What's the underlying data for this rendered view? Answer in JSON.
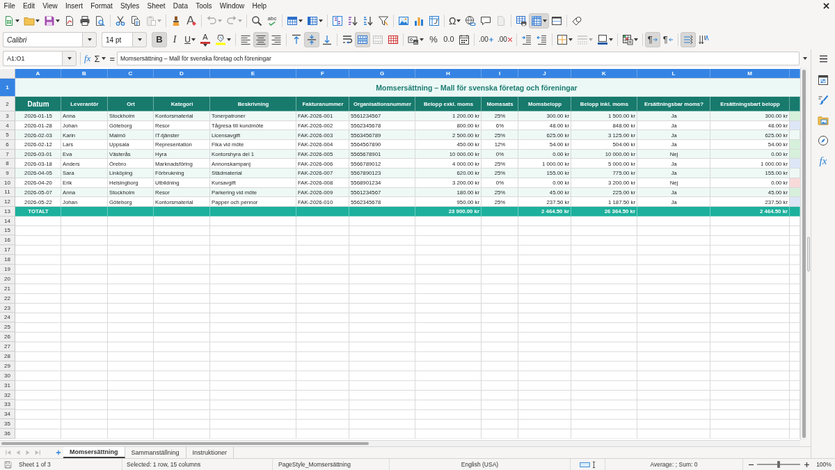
{
  "menu_bar": {
    "items": [
      "File",
      "Edit",
      "View",
      "Insert",
      "Format",
      "Styles",
      "Sheet",
      "Data",
      "Tools",
      "Window",
      "Help"
    ]
  },
  "standard_toolbar": {
    "groups": [
      {
        "items": [
          {
            "kind": "new",
            "dropdown": true,
            "on": false,
            "disabled": false
          },
          {
            "kind": "open",
            "dropdown": true,
            "on": false,
            "disabled": false
          },
          {
            "kind": "save",
            "dropdown": true,
            "on": false,
            "disabled": false
          },
          {
            "kind": "export_pdf",
            "dropdown": false,
            "on": false,
            "disabled": false
          },
          {
            "kind": "print",
            "dropdown": false,
            "on": false,
            "disabled": false
          },
          {
            "kind": "print_preview",
            "dropdown": false,
            "on": false,
            "disabled": false
          }
        ]
      },
      {
        "items": [
          {
            "kind": "cut",
            "dropdown": false,
            "on": false,
            "disabled": false
          },
          {
            "kind": "copy",
            "dropdown": false,
            "on": false,
            "disabled": false
          },
          {
            "kind": "paste",
            "dropdown": true,
            "on": false,
            "disabled": true
          }
        ]
      },
      {
        "items": [
          {
            "kind": "clone_formatting",
            "dropdown": false,
            "on": false,
            "disabled": false
          },
          {
            "kind": "clear_formatting",
            "dropdown": false,
            "on": false,
            "disabled": false
          }
        ]
      },
      {
        "items": [
          {
            "kind": "undo",
            "dropdown": true,
            "on": false,
            "disabled": true
          },
          {
            "kind": "redo",
            "dropdown": true,
            "on": false,
            "disabled": true
          }
        ]
      },
      {
        "items": [
          {
            "kind": "find_replace",
            "dropdown": false,
            "on": false,
            "disabled": false
          },
          {
            "kind": "spelling",
            "glyph": "abc",
            "dropdown": false,
            "on": false,
            "disabled": false
          }
        ]
      },
      {
        "items": [
          {
            "kind": "row",
            "dropdown": true,
            "on": false,
            "disabled": false
          },
          {
            "kind": "column",
            "dropdown": true,
            "on": false,
            "disabled": false
          }
        ]
      },
      {
        "items": [
          {
            "kind": "sort",
            "dropdown": false,
            "on": false,
            "disabled": false
          },
          {
            "kind": "sort_ascending",
            "dropdown": false,
            "on": false,
            "disabled": false
          },
          {
            "kind": "sort_descending",
            "dropdown": false,
            "on": false,
            "disabled": false
          },
          {
            "kind": "autofilter",
            "dropdown": false,
            "on": false,
            "disabled": false
          }
        ]
      },
      {
        "items": [
          {
            "kind": "image",
            "dropdown": false,
            "on": false,
            "disabled": false
          },
          {
            "kind": "chart",
            "dropdown": false,
            "on": false,
            "disabled": false
          },
          {
            "kind": "pivot_table",
            "dropdown": false,
            "on": false,
            "disabled": false
          }
        ]
      },
      {
        "items": [
          {
            "kind": "special_character",
            "glyph": "Ω",
            "dropdown": true,
            "on": false,
            "disabled": false
          },
          {
            "kind": "hyperlink",
            "dropdown": false,
            "on": false,
            "disabled": false
          },
          {
            "kind": "comment",
            "dropdown": false,
            "on": false,
            "disabled": false
          },
          {
            "kind": "header_footer",
            "dropdown": false,
            "on": false,
            "disabled": true
          }
        ]
      },
      {
        "items": [
          {
            "kind": "print_area",
            "dropdown": false,
            "on": false,
            "disabled": false
          },
          {
            "kind": "freeze",
            "dropdown": true,
            "on": true,
            "disabled": false
          },
          {
            "kind": "split_window",
            "dropdown": false,
            "on": false,
            "disabled": false
          }
        ]
      },
      {
        "items": [
          {
            "kind": "draw_functions",
            "dropdown": false,
            "on": false,
            "disabled": false
          }
        ]
      }
    ]
  },
  "formatting_toolbar": {
    "font_name": "Calibri",
    "font_size": "14 pt",
    "groups": [
      {
        "items": [
          {
            "kind": "bold",
            "glyph": "B",
            "dropdown": false,
            "on": true,
            "disabled": false
          },
          {
            "kind": "italic",
            "glyph": "I",
            "dropdown": false,
            "on": false,
            "disabled": false
          },
          {
            "kind": "underline",
            "glyph": "U",
            "dropdown": true,
            "on": false,
            "disabled": false
          },
          {
            "kind": "font_color",
            "glyph": "A",
            "dropdown": true,
            "on": false,
            "disabled": false
          },
          {
            "kind": "highlight",
            "dropdown": true,
            "on": false,
            "disabled": false
          }
        ]
      },
      {
        "items": [
          {
            "kind": "align_left",
            "dropdown": false,
            "on": false,
            "disabled": false
          },
          {
            "kind": "align_center",
            "dropdown": false,
            "on": true,
            "disabled": false
          },
          {
            "kind": "align_right",
            "dropdown": false,
            "on": false,
            "disabled": false
          }
        ]
      },
      {
        "items": [
          {
            "kind": "align_top",
            "dropdown": false,
            "on": false,
            "disabled": false
          },
          {
            "kind": "center_vertically",
            "dropdown": false,
            "on": true,
            "disabled": false
          },
          {
            "kind": "align_bottom",
            "dropdown": false,
            "on": false,
            "disabled": false
          }
        ]
      },
      {
        "items": [
          {
            "kind": "wrap_text",
            "dropdown": false,
            "on": false,
            "disabled": false
          },
          {
            "kind": "merge_center",
            "dropdown": false,
            "on": true,
            "disabled": false
          },
          {
            "kind": "merge_cells",
            "dropdown": false,
            "on": false,
            "disabled": true
          },
          {
            "kind": "unmerge",
            "dropdown": false,
            "on": false,
            "disabled": false
          }
        ]
      },
      {
        "items": [
          {
            "kind": "currency",
            "dropdown": true,
            "on": false,
            "disabled": false
          },
          {
            "kind": "percent",
            "glyph": "%",
            "dropdown": false,
            "on": false,
            "disabled": false
          },
          {
            "kind": "standard_format",
            "glyph": "0.0",
            "dropdown": false,
            "on": false,
            "disabled": false
          },
          {
            "kind": "date",
            "dropdown": false,
            "on": false,
            "disabled": false
          }
        ]
      },
      {
        "items": [
          {
            "kind": "add_decimal",
            "glyph": ".00",
            "dropdown": false,
            "on": false,
            "disabled": false
          },
          {
            "kind": "delete_decimal",
            "glyph": ".00",
            "dropdown": false,
            "on": false,
            "disabled": false
          }
        ]
      },
      {
        "items": [
          {
            "kind": "increase_indent",
            "dropdown": false,
            "on": false,
            "disabled": false
          },
          {
            "kind": "decrease_indent",
            "dropdown": false,
            "on": false,
            "disabled": false
          }
        ]
      },
      {
        "items": [
          {
            "kind": "borders",
            "dropdown": true,
            "on": false,
            "disabled": false
          },
          {
            "kind": "border_style",
            "dropdown": true,
            "on": false,
            "disabled": true
          },
          {
            "kind": "border_color",
            "dropdown": true,
            "on": false,
            "disabled": false
          }
        ]
      },
      {
        "items": [
          {
            "kind": "conditional",
            "dropdown": true,
            "on": false,
            "disabled": false
          }
        ]
      },
      {
        "items": [
          {
            "kind": "ltr",
            "glyph": "¶",
            "dropdown": false,
            "on": true,
            "disabled": false
          },
          {
            "kind": "rtl",
            "glyph": "¶",
            "dropdown": false,
            "on": false,
            "disabled": false
          }
        ]
      },
      {
        "items": [
          {
            "kind": "text_direction",
            "dropdown": false,
            "on": true,
            "disabled": false
          },
          {
            "kind": "vertical_text",
            "dropdown": false,
            "on": false,
            "disabled": false
          }
        ]
      }
    ]
  },
  "formula_bar": {
    "name_box": "A1:O1",
    "function_wizard": "fx",
    "sum": "Σ",
    "formula": "=",
    "content": "Momsersättning – Mall för svenska företag och föreningar"
  },
  "sidebar": {
    "tabs": [
      {
        "kind": "properties",
        "selected": false
      },
      {
        "kind": "styles",
        "selected": false
      },
      {
        "kind": "gallery",
        "selected": false
      },
      {
        "kind": "navigator",
        "selected": false
      },
      {
        "kind": "functions",
        "glyph": "fx",
        "selected": false
      }
    ]
  },
  "sheet": {
    "columns": [
      {
        "letter": "A",
        "selected": true
      },
      {
        "letter": "B",
        "selected": true
      },
      {
        "letter": "C",
        "selected": true
      },
      {
        "letter": "D",
        "selected": true
      },
      {
        "letter": "E",
        "selected": true
      },
      {
        "letter": "F",
        "selected": true
      },
      {
        "letter": "G",
        "selected": true
      },
      {
        "letter": "H",
        "selected": true
      },
      {
        "letter": "I",
        "selected": true
      },
      {
        "letter": "J",
        "selected": true
      },
      {
        "letter": "K",
        "selected": true
      },
      {
        "letter": "L",
        "selected": true
      },
      {
        "letter": "M",
        "selected": true
      }
    ],
    "column_14_header": {
      "selected": true
    },
    "title_row": {
      "number": "1",
      "selected": true,
      "title": "Momsersättning – Mall för svenska företag och föreningar"
    },
    "header_row": {
      "number": "2",
      "selected": false,
      "headings": [
        "Datum",
        "Leverantör",
        "Ort",
        "Kategori",
        "Beskrivning",
        "Fakturanummer",
        "Organisationsnummer",
        "Belopp exkl. moms",
        "Momssats",
        "Momsbelopp",
        "Belopp inkl. moms",
        "Ersättningsbar moms?",
        "Ersättningsbart belopp"
      ]
    },
    "rows": [
      {
        "number": "3",
        "selected": false,
        "cells": [
          "2026-01-15",
          "Anna",
          "Stockholm",
          "Kontorsmaterial",
          "Tonerpatroner",
          "FAK-2026-001",
          "5561234567",
          "1 200.00 kr",
          "25%",
          "300.00 kr",
          "1 500.00 kr",
          "Ja",
          "300.00 kr"
        ],
        "column_14": {
          "color": "#d6f0db"
        }
      },
      {
        "number": "4",
        "selected": false,
        "cells": [
          "2026-01-28",
          "Johan",
          "Göteborg",
          "Resor",
          "Tågresa till kundmöte",
          "FAK-2026-002",
          "5562345678",
          "800.00 kr",
          "6%",
          "48.00 kr",
          "848.00 kr",
          "Ja",
          "48.00 kr"
        ],
        "column_14": {
          "color": "#dde6f6"
        }
      },
      {
        "number": "5",
        "selected": false,
        "cells": [
          "2026-02-03",
          "Karin",
          "Malmö",
          "IT-tjänster",
          "Licensavgift",
          "FAK-2026-003",
          "5563456789",
          "2 500.00 kr",
          "25%",
          "625.00 kr",
          "3 125.00 kr",
          "Ja",
          "625.00 kr"
        ]
      },
      {
        "number": "6",
        "selected": false,
        "cells": [
          "2026-02-12",
          "Lars",
          "Uppsala",
          "Representation",
          "Fika vid möte",
          "FAK-2026-004",
          "5564567890",
          "450.00 kr",
          "12%",
          "54.00 kr",
          "504.00 kr",
          "Ja",
          "54.00 kr"
        ],
        "column_14": {
          "color": "#d6f0db"
        }
      },
      {
        "number": "7",
        "selected": false,
        "cells": [
          "2026-03-01",
          "Eva",
          "Västerås",
          "Hyra",
          "Kontorshyra del 1",
          "FAK-2026-005",
          "5565678901",
          "10 000.00 kr",
          "0%",
          "0.00 kr",
          "10 000.00 kr",
          "Nej",
          "0.00 kr"
        ],
        "column_14": {
          "color": "#d6f0db"
        }
      },
      {
        "number": "8",
        "selected": false,
        "cells": [
          "2026-03-18",
          "Anders",
          "Örebro",
          "Marknadsföring",
          "Annonskampanj",
          "FAK-2026-006",
          "5566789012",
          "4 000.00 kr",
          "25%",
          "1 000.00 kr",
          "5 000.00 kr",
          "Ja",
          "1 000.00 kr"
        ],
        "column_14": {
          "color": "#dde6f6"
        }
      },
      {
        "number": "9",
        "selected": false,
        "cells": [
          "2026-04-05",
          "Sara",
          "Linköping",
          "Förbrukning",
          "Städmaterial",
          "FAK-2026-007",
          "5567890123",
          "620.00 kr",
          "25%",
          "155.00 kr",
          "775.00 kr",
          "Ja",
          "155.00 kr"
        ]
      },
      {
        "number": "10",
        "selected": false,
        "cells": [
          "2026-04-20",
          "Erik",
          "Helsingborg",
          "Utbildning",
          "Kursavgift",
          "FAK-2026-008",
          "5568901234",
          "3 200.00 kr",
          "0%",
          "0.00 kr",
          "3 200.00 kr",
          "Nej",
          "0.00 kr"
        ],
        "column_14": {
          "color": "#f8dada"
        }
      },
      {
        "number": "11",
        "selected": false,
        "cells": [
          "2026-05-07",
          "Anna",
          "Stockholm",
          "Resor",
          "Parkering vid möte",
          "FAK-2026-009",
          "5561234567",
          "180.00 kr",
          "25%",
          "45.00 kr",
          "225.00 kr",
          "Ja",
          "45.00 kr"
        ],
        "column_14": {
          "color": "#d6f0db"
        }
      },
      {
        "number": "12",
        "selected": false,
        "cells": [
          "2026-05-22",
          "Johan",
          "Göteborg",
          "Kontorsmaterial",
          "Papper och pennor",
          "FAK-2026-010",
          "5562345678",
          "950.00 kr",
          "25%",
          "237.50 kr",
          "1 187.50 kr",
          "Ja",
          "237.50 kr"
        ],
        "column_14": {
          "color": "#dde6f6"
        }
      }
    ],
    "total_row": {
      "number": "13",
      "selected": false,
      "label": "TOTALT",
      "net_total": "23 900.00 kr",
      "vat_total": "2 464.50 kr",
      "gross_total": "26 364.50 kr",
      "reclaimable_total": "2 464.50 kr"
    },
    "empty_rows": [
      {
        "number": "14",
        "selected": false
      },
      {
        "number": "15",
        "selected": false
      },
      {
        "number": "16",
        "selected": false
      },
      {
        "number": "17",
        "selected": false
      },
      {
        "number": "18",
        "selected": false
      },
      {
        "number": "19",
        "selected": false
      },
      {
        "number": "20",
        "selected": false
      },
      {
        "number": "21",
        "selected": false
      },
      {
        "number": "22",
        "selected": false
      },
      {
        "number": "23",
        "selected": false
      },
      {
        "number": "24",
        "selected": false
      },
      {
        "number": "25",
        "selected": false
      },
      {
        "number": "26",
        "selected": false
      },
      {
        "number": "27",
        "selected": false
      },
      {
        "number": "28",
        "selected": false
      },
      {
        "number": "29",
        "selected": false
      },
      {
        "number": "30",
        "selected": false
      },
      {
        "number": "31",
        "selected": false
      },
      {
        "number": "32",
        "selected": false
      },
      {
        "number": "33",
        "selected": false
      },
      {
        "number": "34",
        "selected": false
      },
      {
        "number": "35",
        "selected": false
      },
      {
        "number": "36",
        "selected": false
      }
    ]
  },
  "sheet_navigation": [
    {
      "kind": "first",
      "disabled": true
    },
    {
      "kind": "previous",
      "disabled": true
    },
    {
      "kind": "next",
      "disabled": true
    },
    {
      "kind": "last",
      "disabled": true
    }
  ],
  "sheet_tabs": [
    {
      "label": "Momsersättning",
      "selected": true
    },
    {
      "label": "Sammanställning",
      "selected": false
    },
    {
      "label": "Instruktioner",
      "selected": false
    }
  ],
  "status_bar": {
    "sheet_position": "Sheet 1 of 3",
    "selection": "Selected: 1 row, 15 columns",
    "page_style": "PageStyle_Momsersättning",
    "language": "English (USA)",
    "statistics": "Average: ; Sum: 0",
    "zoom": {
      "level": 0.5,
      "reading": "100%"
    }
  }
}
